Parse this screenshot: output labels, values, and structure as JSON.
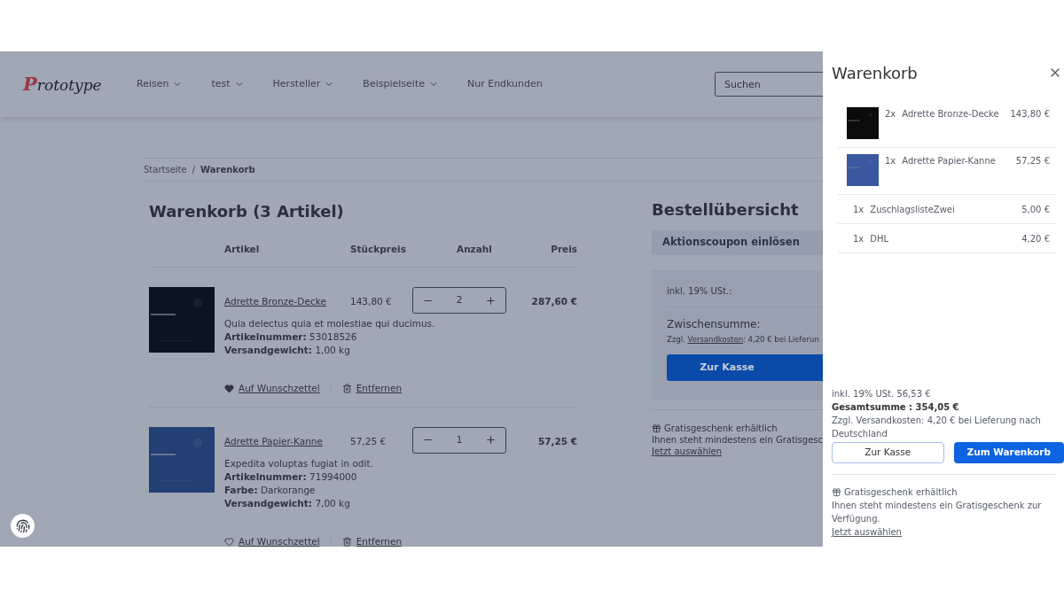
{
  "header": {
    "logo": "Prototype",
    "nav": [
      {
        "label": "Reisen",
        "dropdown": true
      },
      {
        "label": "test",
        "dropdown": true
      },
      {
        "label": "Hersteller",
        "dropdown": true
      },
      {
        "label": "Beispielseite",
        "dropdown": true
      },
      {
        "label": "Nur Endkunden",
        "dropdown": false
      }
    ],
    "search": {
      "placeholder": "Suchen"
    }
  },
  "breadcrumb": {
    "separator": "/",
    "items": [
      {
        "label": "Startseite",
        "current": false
      },
      {
        "label": "Warenkorb",
        "current": true
      }
    ]
  },
  "cart": {
    "title": "Warenkorb (3 Artikel)",
    "columns": [
      "Artikel",
      "Stückpreis",
      "Anzahl",
      "Preis"
    ],
    "items": [
      {
        "name": "Adrette Bronze-Decke",
        "unit_price": "143,80 €",
        "quantity": "2",
        "total": "287,60 €",
        "description": "Quia delectus quia et molestiae qui ducimus.",
        "details": [
          {
            "label": "Artikelnummer:",
            "value": "53018526"
          },
          {
            "label": "Versandgewicht:",
            "value": "1,00 kg"
          }
        ],
        "wishlist": "Auf Wunschzettel",
        "wishlisted": true,
        "remove": "Entfernen"
      },
      {
        "name": "Adrette Papier-Kanne",
        "unit_price": "57,25 €",
        "quantity": "1",
        "total": "57,25 €",
        "description": "Expedita voluptas fugiat in odit.",
        "details": [
          {
            "label": "Artikelnummer:",
            "value": "71994000"
          },
          {
            "label": "Farbe:",
            "value": "Darkorange"
          },
          {
            "label": "Versandgewicht:",
            "value": "7,00 kg"
          }
        ],
        "wishlist": "Auf Wunschzettel",
        "wishlisted": false,
        "remove": "Entfernen"
      }
    ]
  },
  "summary": {
    "title": "Bestellübersicht",
    "coupon": "Aktionscoupon einlösen",
    "tax": "inkl. 19% USt.:",
    "subtotal": "Zwischensumme:",
    "shipping_prefix": "Zzgl.",
    "shipping_link": "Versandkosten",
    "shipping_rest": ": 4,20 € bei Lieferun",
    "checkout": "Zur Kasse",
    "gift_title": "Gratisgeschenk erhältlich",
    "gift_text": "Ihnen steht mindestens ein Gratisgesc",
    "gift_link": "Jetzt auswählen"
  },
  "drawer": {
    "title": "Warenkorb",
    "items": [
      {
        "kind": "product",
        "qty": "2x",
        "name": "Adrette Bronze-Decke",
        "price": "143,80 €"
      },
      {
        "kind": "product",
        "qty": "1x",
        "name": "Adrette Papier-Kanne",
        "price": "57,25 €"
      },
      {
        "kind": "fee",
        "qty": "1x",
        "name": "ZuschlagslisteZwei",
        "price": "5,00 €"
      },
      {
        "kind": "fee",
        "qty": "1x",
        "name": "DHL",
        "price": "4,20 €"
      }
    ],
    "tax": "inkl. 19% USt. 56,53 €",
    "total": "Gesamtsumme : 354,05 €",
    "shipping": "Zzgl. Versandkosten: 4,20 € bei Lieferung nach Deutschland",
    "buttons": [
      {
        "label": "Zur Kasse",
        "primary": false
      },
      {
        "label": "Zum Warenkorb",
        "primary": true
      }
    ],
    "gift_title": "Gratisgeschenk erhältlich",
    "gift_text": "Ihnen steht mindestens ein Gratisgeschenk zur Verfügung.",
    "gift_link": "Jetzt auswählen"
  }
}
